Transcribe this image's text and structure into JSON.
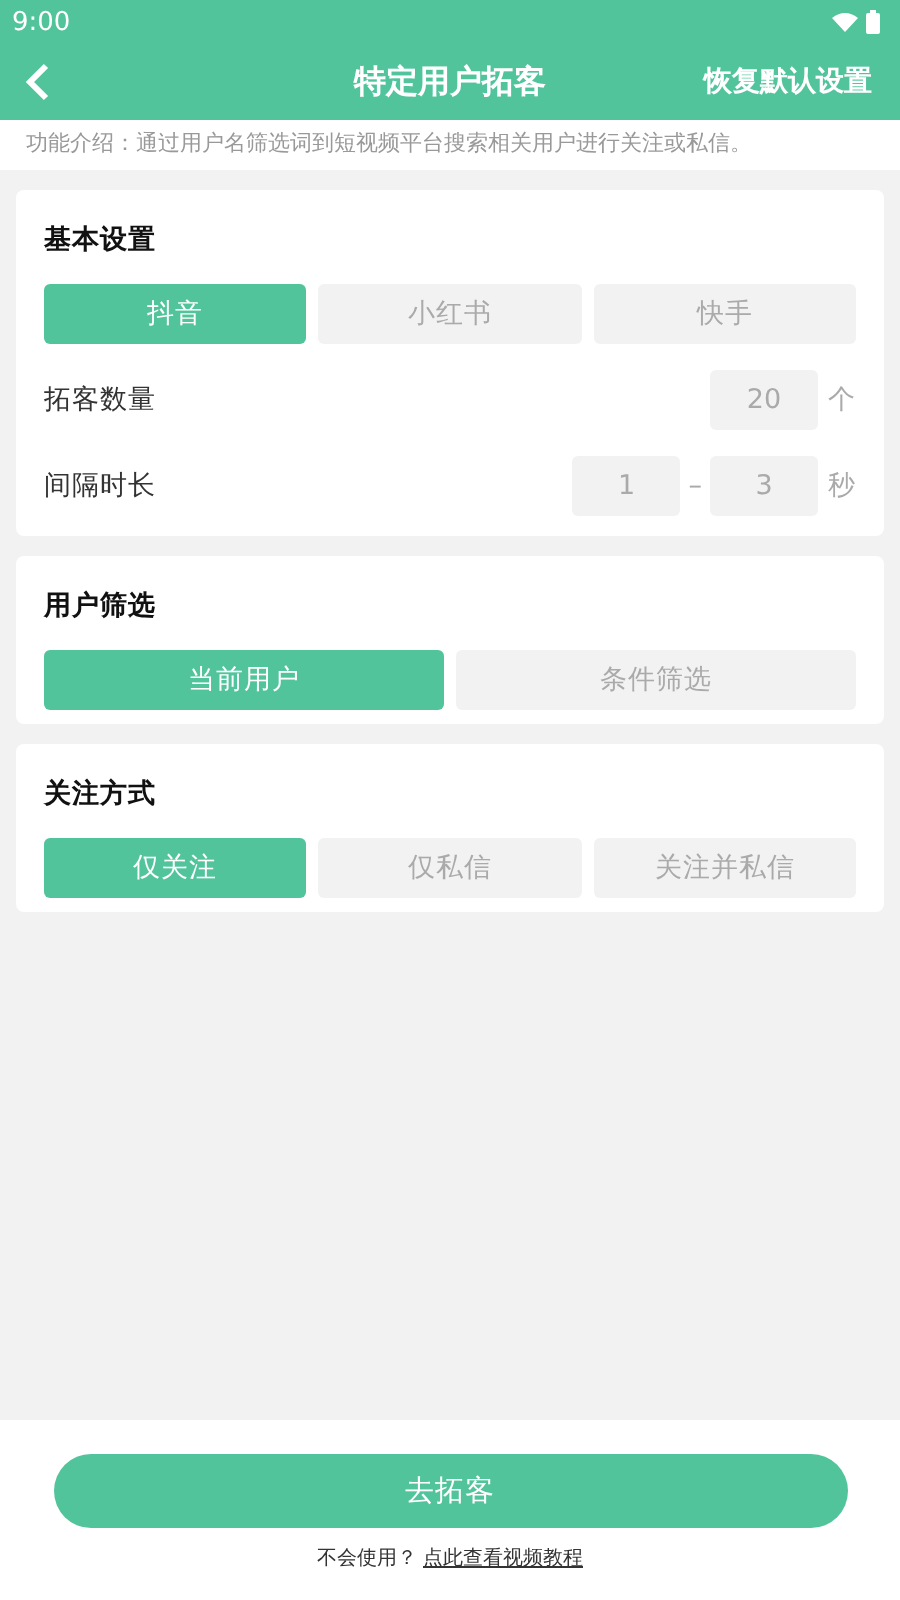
{
  "status_bar": {
    "time": "9:00"
  },
  "header": {
    "title": "特定用户拓客",
    "action": "恢复默认设置"
  },
  "intro": "功能介绍：通过用户名筛选词到短视频平台搜索相关用户进行关注或私信。",
  "sections": [
    {
      "title": "基本设置",
      "options": [
        {
          "label": "抖音",
          "selected": true
        },
        {
          "label": "小红书",
          "selected": false
        },
        {
          "label": "快手",
          "selected": false
        }
      ],
      "rows": [
        {
          "label": "拓客数量",
          "fields": [
            "20"
          ],
          "unit": "个"
        },
        {
          "label": "间隔时长",
          "fields": [
            "1",
            "3"
          ],
          "separator": "–",
          "unit": "秒"
        }
      ]
    },
    {
      "title": "用户筛选",
      "options": [
        {
          "label": "当前用户",
          "selected": true
        },
        {
          "label": "条件筛选",
          "selected": false
        }
      ]
    },
    {
      "title": "关注方式",
      "options": [
        {
          "label": "仅关注",
          "selected": true
        },
        {
          "label": "仅私信",
          "selected": false
        },
        {
          "label": "关注并私信",
          "selected": false
        }
      ]
    }
  ],
  "footer": {
    "button": "去拓客",
    "hint": "不会使用？",
    "link": "点此查看视频教程"
  }
}
